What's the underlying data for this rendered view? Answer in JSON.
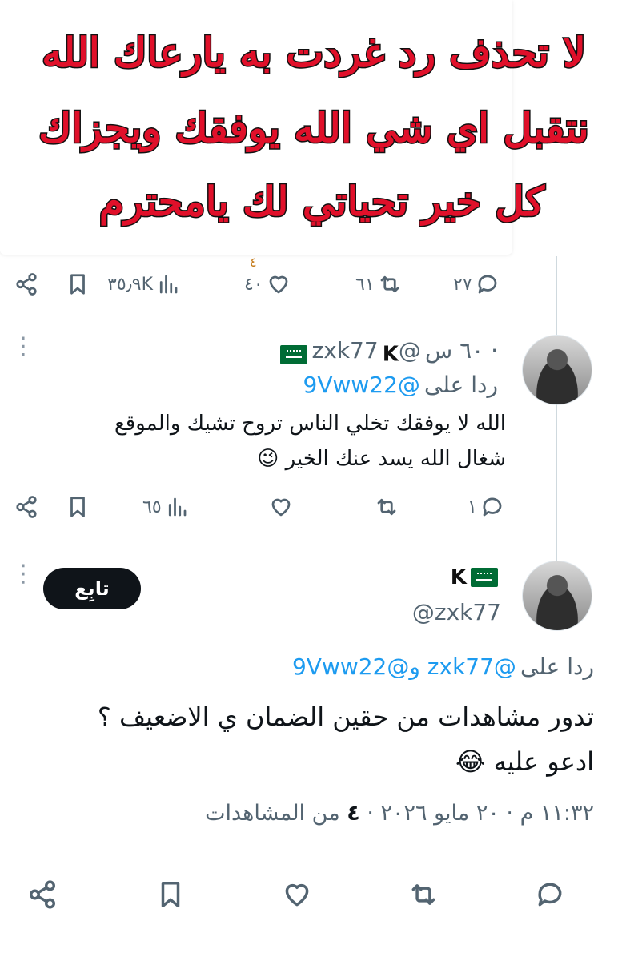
{
  "quote_image": {
    "lines": [
      "لا تحذف رد غردت به يارعاك الله",
      "نتقبل اي شي الله يوفقك ويجزاك",
      "كل خير تحياتي لك يامحترم"
    ],
    "text_color": "#e0102a"
  },
  "tweet1_actions": {
    "views": "٣٥٫٩K",
    "likes": "٤٠",
    "retweets": "٦١",
    "replies": "٢٧",
    "small_mark": "٤"
  },
  "reply1": {
    "badge_letter": "K",
    "handle": "@zxk77",
    "time": "· ٦٠ س",
    "replying_prefix": "ردا على",
    "replying_to": "@9Vww22",
    "text_line1": "الله لا يوفقك تخلي الناس تروح تشيك والموقع",
    "text_line2": "شغال  الله يسد  عنك  الخير 😉",
    "views": "٦٥",
    "replies": "١"
  },
  "main_tweet": {
    "badge_letter": "K",
    "handle": "@zxk77",
    "follow_label": "تابِع",
    "replying_prefix": "ردا على",
    "replying_to": "@zxk77 و@9Vww22",
    "text_line1": "تدور مشاهدات من حقين الضمان ي  الاضعيف ؟",
    "text_line2": "ادعو عليه 😂",
    "meta_time": "١١:٣٢ م · ٢٠ مايو ٢٠٢٦ · ",
    "meta_views_num": "٤",
    "meta_views_label": " من المشاهدات"
  },
  "colors": {
    "accent": "#1d9bf0",
    "secondary_text": "#536471",
    "primary_text": "#0f1419",
    "flag_green": "#006c35"
  },
  "icons": [
    "share-icon",
    "bookmark-icon",
    "views-icon",
    "like-icon",
    "retweet-icon",
    "reply-icon",
    "more-icon",
    "saudi-flag-icon"
  ]
}
